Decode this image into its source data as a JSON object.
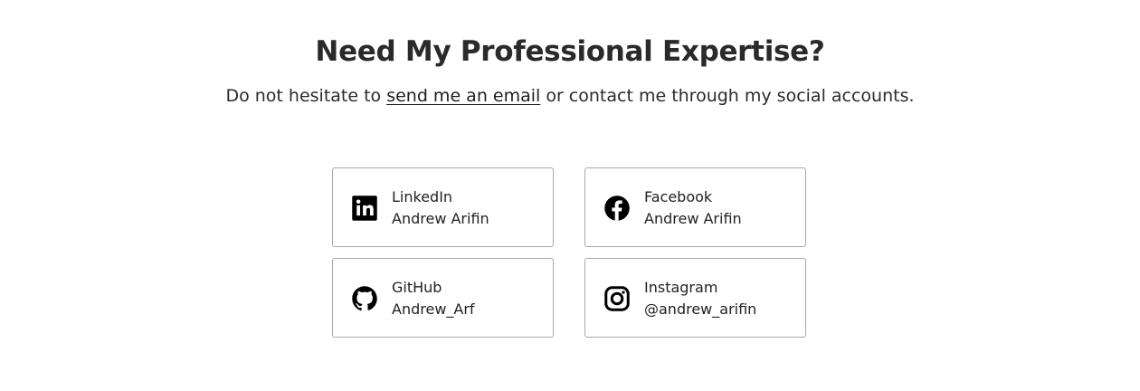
{
  "heading": "Need My Professional Expertise?",
  "subtext": {
    "before": "Do not hesitate to ",
    "link": "send me an email",
    "after": " or contact me through my social accounts."
  },
  "socials": [
    {
      "platform": "LinkedIn",
      "handle": "Andrew Arifin",
      "icon": "linkedin-icon"
    },
    {
      "platform": "Facebook",
      "handle": "Andrew Arifin",
      "icon": "facebook-icon"
    },
    {
      "platform": "GitHub",
      "handle": "Andrew_Arf",
      "icon": "github-icon"
    },
    {
      "platform": "Instagram",
      "handle": "@andrew_arifin",
      "icon": "instagram-icon"
    }
  ],
  "colors": {
    "text": "#222222",
    "border": "#a8a8a8",
    "background": "#ffffff"
  }
}
